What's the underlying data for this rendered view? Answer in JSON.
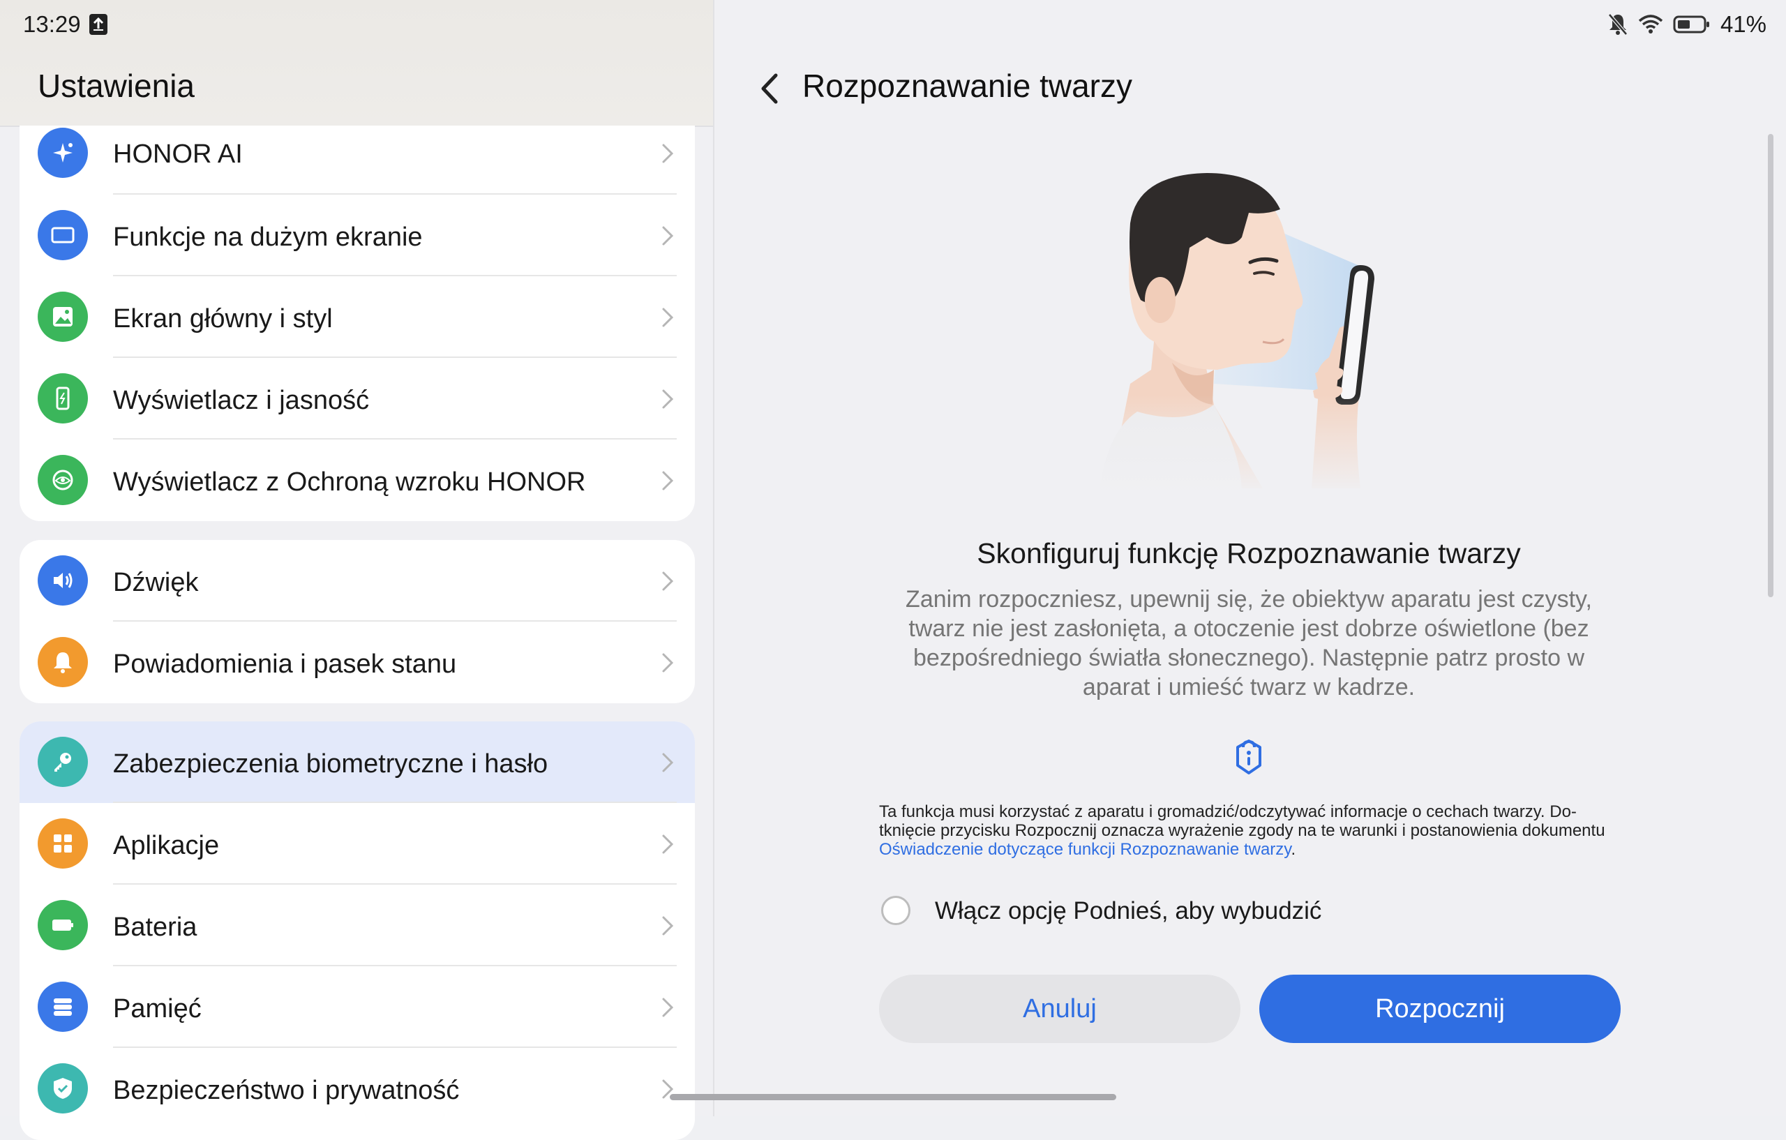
{
  "status_bar": {
    "time": "13:29",
    "battery_percent": "41%"
  },
  "left": {
    "title": "Ustawienia",
    "groups": [
      {
        "items": [
          {
            "label": "HONOR AI",
            "icon": "sparkle-icon",
            "color": "#3a78e8"
          },
          {
            "label": "Funkcje na dużym ekranie",
            "icon": "tablet-icon",
            "color": "#3a78e8"
          },
          {
            "label": "Ekran główny i styl",
            "icon": "image-icon",
            "color": "#3bb65b"
          },
          {
            "label": "Wyświetlacz i jasność",
            "icon": "display-brightness-icon",
            "color": "#3bb65b"
          },
          {
            "label": "Wyświetlacz z Ochroną wzroku HONOR",
            "icon": "eye-comfort-icon",
            "color": "#3bb65b"
          }
        ]
      },
      {
        "items": [
          {
            "label": "Dźwięk",
            "icon": "speaker-icon",
            "color": "#3a78e8"
          },
          {
            "label": "Powiadomienia i pasek stanu",
            "icon": "bell-icon",
            "color": "#f29a2e"
          }
        ]
      },
      {
        "items": [
          {
            "label": "Zabezpieczenia biometryczne i hasło",
            "icon": "key-icon",
            "color": "#3db8b0",
            "selected": true
          },
          {
            "label": "Aplikacje",
            "icon": "apps-grid-icon",
            "color": "#f29a2e"
          },
          {
            "label": "Bateria",
            "icon": "battery-icon",
            "color": "#3bb65b"
          },
          {
            "label": "Pamięć",
            "icon": "storage-icon",
            "color": "#3a78e8"
          },
          {
            "label": "Bezpieczeństwo i prywatność",
            "icon": "shield-check-icon",
            "color": "#3db8b0"
          }
        ]
      }
    ]
  },
  "right": {
    "title": "Rozpoznawanie twarzy",
    "heading": "Skonfiguruj funkcję Rozpoznawanie twarzy",
    "description": "Zanim rozpoczniesz, upewnij się, że obiektyw aparatu jest czysty, twarz nie jest zasłonięta, a otoczenie jest dobrze oświetlone (bez bezpośredniego światła słonecznego). Następnie patrz prosto w aparat i umieść twarz w kadrze.",
    "notice_text": "Ta funkcja musi korzystać z aparatu i gromadzić/odczytywać informacje o cechach twarzy. Do-tknięcie przycisku Rozpocznij oznacza wyrażenie zgody na te warunki i postanowienia dokumentu",
    "notice_link": "Oświadczenie dotyczące funkcji Rozpoznawanie twarzy",
    "notice_end": ".",
    "raise_to_wake_label": "Włącz opcję Podnieś, aby wybudzić",
    "raise_to_wake_checked": false,
    "cancel_label": "Anuluj",
    "start_label": "Rozpocznij"
  },
  "colors": {
    "accent": "#2f6ee2",
    "selected_row": "#e3e9fa"
  }
}
